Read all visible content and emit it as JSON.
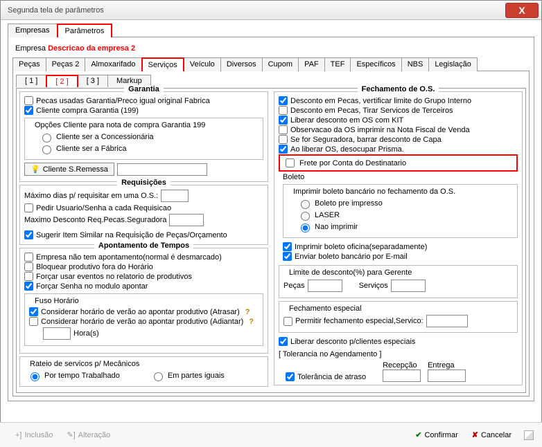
{
  "window": {
    "title": "Segunda tela de parâmetros",
    "close": "X"
  },
  "outerTabs": {
    "empresas": "Empresas",
    "parametros": "Parâmetros"
  },
  "empresaLine": {
    "label": "Empresa",
    "desc": "Descricao da empresa 2"
  },
  "innerTabs": {
    "pecas": "Peças",
    "pecas2": "Peças 2",
    "almox": "Almoxarifado",
    "servicos": "Serviços",
    "veiculo": "Veículo",
    "diversos": "Diversos",
    "cupom": "Cupom",
    "paf": "PAF",
    "tef": "TEF",
    "espec": "Específicos",
    "nbs": "NBS",
    "legis": "Legislação"
  },
  "subTabs": {
    "t1": "[ 1 ]",
    "t2": "[ 2 ]",
    "t3": "[ 3 ]",
    "markup": "Markup"
  },
  "garantia": {
    "title": "Garantia",
    "pecasUsadas": "Pecas usadas Garantia/Preco igual original Fabrica",
    "clienteCompra": "Cliente compra Garantia (199)",
    "opcoesCliente": "Opções Cliente para nota de compra Garantia 199",
    "concess": "Cliente ser a Concessionária",
    "fabrica": "Cliente ser a Fábrica",
    "btnClienteSR": "Cliente S.Remessa"
  },
  "requisicoes": {
    "title": "Requisições",
    "maxDias": "Máximo dias p/ requisitar em uma O.S.:",
    "pedirUsuario": "Pedir Usuario/Senha a cada Requisicao",
    "maxDesc": "Maximo Desconto Req.Pecas.Seguradora",
    "sugerir": "Sugerir Item Similar na Requisição de Peças/Orçamento"
  },
  "apontamento": {
    "title": "Apontamento de Tempos",
    "empresaNao": "Empresa não tem apontamento(normal é desmarcado)",
    "bloquear": "Bloquear produtivo fora do Horário",
    "forcarUsar": "Forçar usar eventos no relatorio de produtivos",
    "forcarSenha": "Forçar Senha no modulo apontar",
    "fusoTitle": "Fuso Horário",
    "considAtrasar": "Considerar horário de verão ao apontar produtivo (Atrasar)",
    "considAdiantar": "Considerar horário de verão ao apontar produtivo (Adiantar)",
    "horas": "Hora(s)"
  },
  "rateio": {
    "title": "Rateio de servicos p/ Mecânicos",
    "porTempo": "Por tempo Trabalhado",
    "partesIguais": "Em partes iguais"
  },
  "fechamento": {
    "title": "Fechamento de O.S.",
    "descGrupo": "Desconto em Pecas, vertificar limite do Grupo Interno",
    "descTerc": "Desconto em Pecas, Tirar Servicos de Terceiros",
    "liberarKit": "Liberar desconto em OS com KIT",
    "observ": "Observacao da OS imprimir na Nota Fiscal de Venda",
    "seguradora": "Se for Seguradora, barrar desconto de Capa",
    "liberarPrisma": "Ao liberar OS, desocupar Prisma.",
    "freteConta": "Frete por Conta do Destinatario"
  },
  "boleto": {
    "title": "Boleto",
    "imprimirTitle": "Imprimir boleto bancário no fechamento da O.S.",
    "preImpresso": "Boleto pre impresso",
    "laser": "LASER",
    "naoImprimir": "Nao imprimir",
    "oficina": "Imprimir boleto oficina(separadamente)",
    "email": "Enviar boleto bancário por E-mail"
  },
  "limite": {
    "title": "Limite de desconto(%) para Gerente",
    "pecas": "Peças",
    "servicos": "Serviços"
  },
  "fechEsp": {
    "title": "Fechamento especial",
    "permitir": "Permitir fechamento especial,Servico:"
  },
  "liberarEsp": "Liberar desconto p/clientes especiais",
  "tolerancia": {
    "title": "[ Tolerancia no Agendamento ]",
    "recep": "Recepção",
    "entrega": "Entrega",
    "atraso": "Tolerância de atraso"
  },
  "bottom": {
    "inclusao": "Inclusão",
    "alteracao": "Alteração",
    "confirmar": "Confirmar",
    "cancelar": "Cancelar"
  }
}
